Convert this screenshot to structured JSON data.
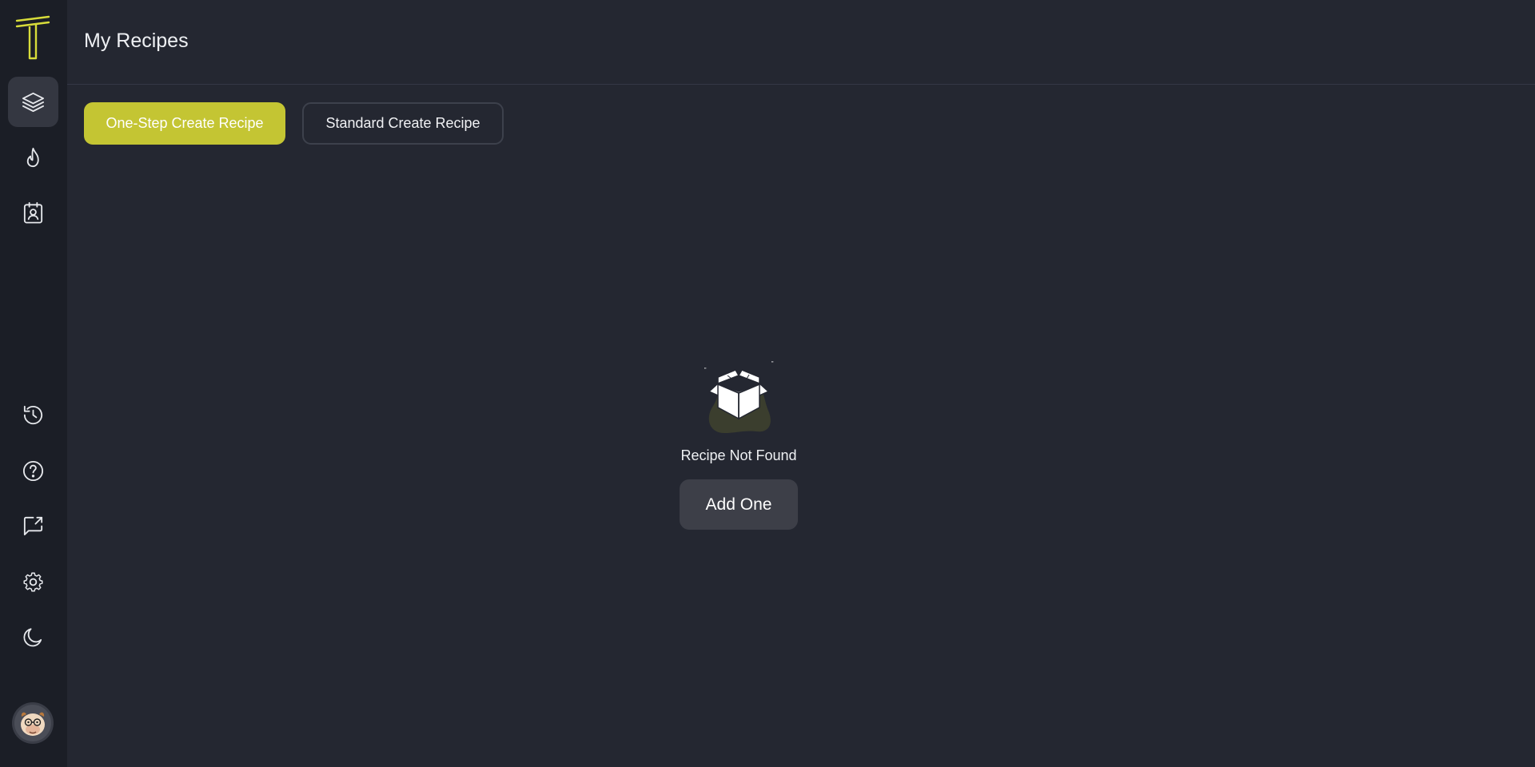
{
  "app": {
    "logo_icon": "t-logo-icon"
  },
  "sidebar": {
    "items": [
      {
        "icon": "layers-icon",
        "name": "sidebar-item-recipes",
        "active": true
      },
      {
        "icon": "flame-icon",
        "name": "sidebar-item-hot",
        "active": false
      },
      {
        "icon": "badge-icon",
        "name": "sidebar-item-profile",
        "active": false
      }
    ],
    "bottom_items": [
      {
        "icon": "history-icon",
        "name": "sidebar-item-history"
      },
      {
        "icon": "help-icon",
        "name": "sidebar-item-help"
      },
      {
        "icon": "feedback-icon",
        "name": "sidebar-item-feedback"
      },
      {
        "icon": "gear-icon",
        "name": "sidebar-item-settings"
      },
      {
        "icon": "moon-icon",
        "name": "sidebar-item-theme"
      }
    ],
    "avatar_icon": "user-avatar"
  },
  "header": {
    "title": "My Recipes"
  },
  "actions": {
    "one_step_label": "One-Step Create Recipe",
    "standard_label": "Standard Create Recipe"
  },
  "empty_state": {
    "message": "Recipe Not Found",
    "button_label": "Add One",
    "illustration_icon": "open-box-icon"
  },
  "colors": {
    "accent": "#c4c533",
    "background": "#242731",
    "sidebar": "#1b1e26"
  }
}
